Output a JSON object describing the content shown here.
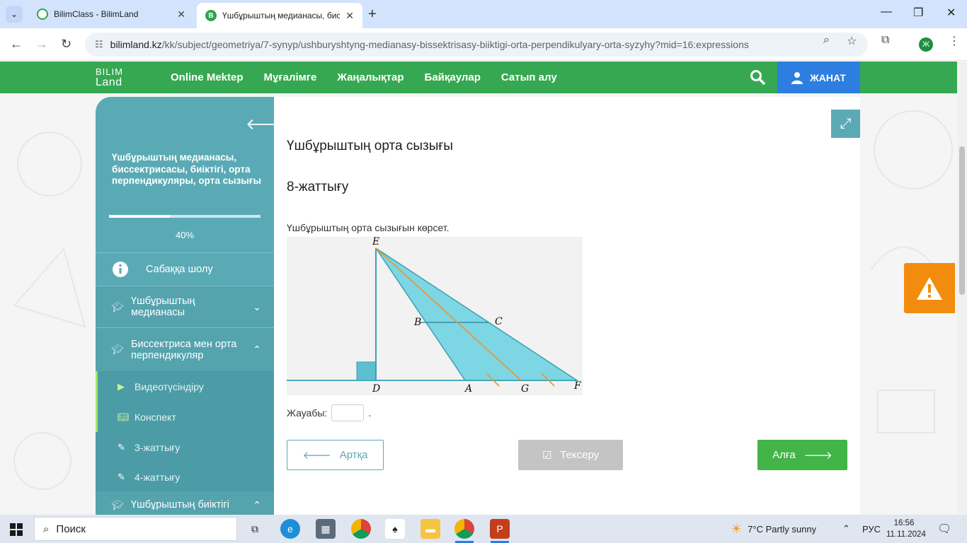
{
  "browser": {
    "tabs": [
      {
        "title": "BilimClass - BilimLand",
        "active": false
      },
      {
        "title": "Үшбұрыштың медианасы, биссектрисасы, биіктігі, орта перпендикуляры, орта сызығы",
        "active": true
      }
    ],
    "url_host": "bilimland.kz",
    "url_path": "/kk/subject/geometriya/7-synyp/ushburyshtyng-medianasy-bissektrisasy-biiktigi-orta-perpendikulyary-orta-syzyhy?mid=16:expressions",
    "profile_initial": "Ж"
  },
  "header": {
    "logo_line1": "BILIM",
    "logo_line2": "Land",
    "nav": [
      "Online Mektep",
      "Мұғалімге",
      "Жаңалықтар",
      "Байқаулар",
      "Сатып алу"
    ],
    "login_label": "ЖАНАТ",
    "brand_color": "#36a852"
  },
  "sidebar": {
    "title": "Үшбұрыштың медианасы, биссектрисасы, биіктігі, орта перпендикуляры, орта сызығы",
    "progress_percent": 40,
    "progress_label": "40%",
    "overview_label": "Сабаққа шолу",
    "sections": [
      {
        "label": "Үшбұрыштың медианасы",
        "expanded": false
      },
      {
        "label": "Биссектриса мен орта перпендикуляр",
        "expanded": true
      },
      {
        "label": "Үшбұрыштың биіктігі",
        "expanded": true
      }
    ],
    "subitems": [
      {
        "label": "Видеотүсіндіру",
        "icon": "play-icon"
      },
      {
        "label": "Конспект",
        "icon": "book-icon"
      },
      {
        "label": "3-жаттығу",
        "icon": "edit-icon"
      },
      {
        "label": "4-жаттығу",
        "icon": "edit-icon"
      }
    ]
  },
  "main": {
    "title": "Үшбұрыштың орта сызығы",
    "exercise": "8-жаттығу",
    "task": "Үшбұрыштың орта сызығын көрсет.",
    "figure_labels": {
      "E": "E",
      "B": "B",
      "C": "C",
      "D": "D",
      "A": "A",
      "G": "G",
      "F": "F"
    },
    "answer_label": "Жауабы:",
    "answer_value": "",
    "answer_suffix": ".",
    "back_label": "Артқа",
    "check_label": "Тексеру",
    "next_label": "Алға"
  },
  "taskbar": {
    "search_label": "Поиск",
    "weather": "7°C  Partly sunny",
    "lang": "РУС",
    "time": "16:56",
    "date": "11.11.2024"
  }
}
